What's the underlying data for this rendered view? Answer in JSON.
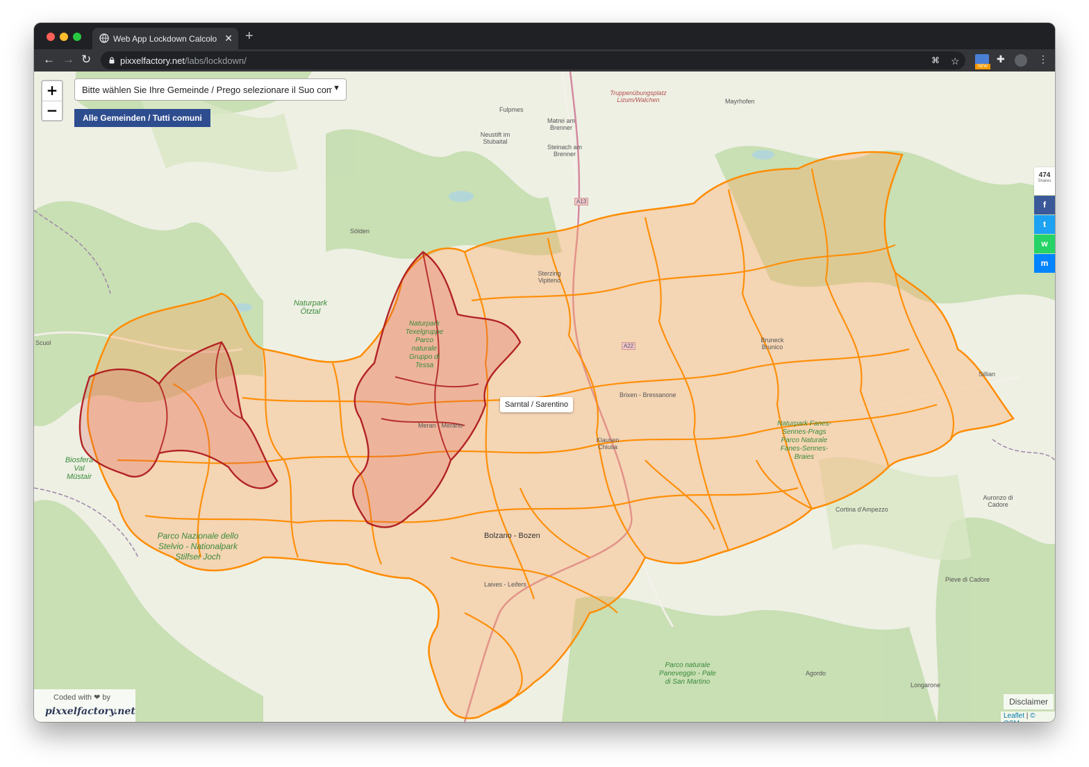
{
  "browser": {
    "tab_title": "Web App Lockdown Calcolo Ar",
    "tab_close": "✕",
    "new_tab": "+",
    "url_domain": "pixxelfactory.net",
    "url_path": "/labs/lockdown/"
  },
  "map": {
    "zoom_in": "+",
    "zoom_out": "−",
    "select_value": "Bitte wählen Sie Ihre Gemeinde / Prego selezionare il Suo comune",
    "all_button": "Alle Gemeinden / Tutti comuni",
    "tooltip": "Sarntal / Sarentino",
    "highlight_color": "#b22222",
    "region_color": "#ff8c00",
    "place_labels": {
      "solden": "Sölden",
      "fulpmes": "Fulpmes",
      "mayrhofen": "Mayrhofen",
      "matrei": "Matrei am Brenner",
      "neustift": "Neustift im Stubaital",
      "steinach": "Steinach am Brenner",
      "sterzing": "Sterzing Vipiteno",
      "bruneck": "Bruneck Brunico",
      "brixen": "Brixen - Bressanone",
      "klausen": "Klausen Chiusa",
      "meran": "Meran - Merano",
      "bolzano": "Bolzano - Bozen",
      "laives": "Laives - Leifers",
      "scuol": "Scuol",
      "sillian": "Sillian",
      "cortina": "Cortina d'Ampezzo",
      "auronzo": "Auronzo di Cadore",
      "pieve": "Pieve di Cadore",
      "agordo": "Agordo",
      "longarone": "Longarone",
      "a13": "A13",
      "a22": "A22"
    },
    "park_labels": {
      "otztal": "Naturpark Ötztal",
      "stelvio": "Parco Nazionale dello Stelvio - Nationalpark Stilfser Joch",
      "mustair": "Biosfera Val Müstair",
      "texel": "Naturpark Texelgruppe Parco naturale Gruppo di Tessa",
      "fanes": "Naturpark Fanes-Sennes-Prags Parco Naturale Fanes-Sennes-Braies",
      "paneveggio": "Parco naturale Paneveggio - Pale di San Martino",
      "truppen": "Truppenübungsplatz Lizum/Walchen"
    }
  },
  "share": {
    "count": "474",
    "count_label": "Shares",
    "facebook": "f",
    "twitter": "t",
    "whatsapp": "w",
    "messenger": "m",
    "colors": {
      "facebook": "#3b5998",
      "twitter": "#1da1f2",
      "whatsapp": "#25d366",
      "messenger": "#0084ff"
    }
  },
  "footer": {
    "coded_with": "Coded with ❤ by",
    "brand": "pixxelfactory.net",
    "disclaimer": "Disclaimer",
    "leaflet": "Leaflet",
    "osm": "© OSM"
  }
}
